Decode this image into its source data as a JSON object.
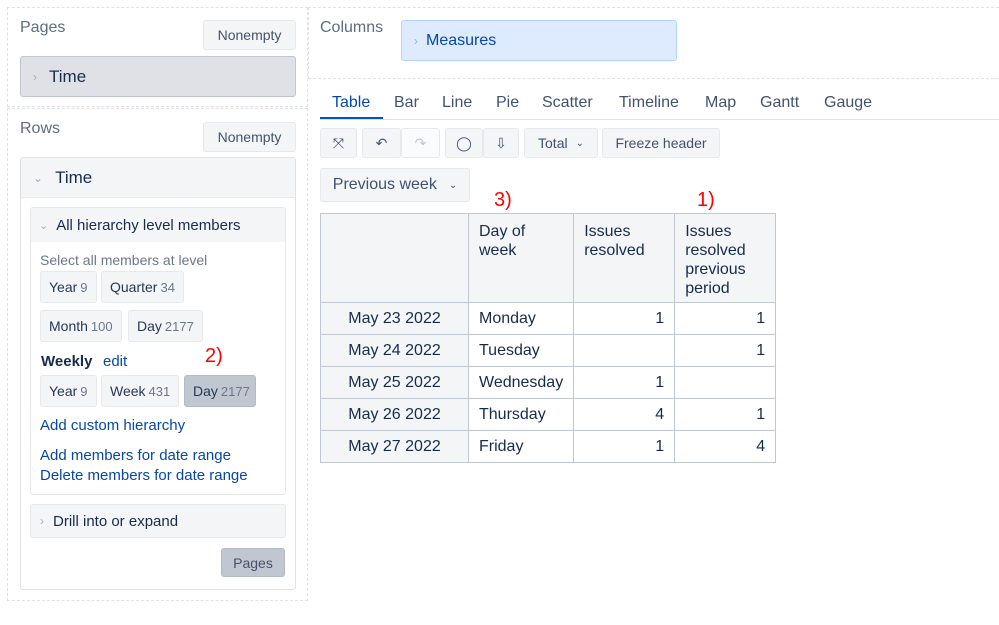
{
  "pages": {
    "title": "Pages",
    "nonempty": "Nonempty",
    "dimension": "Time"
  },
  "rows": {
    "title": "Rows",
    "nonempty": "Nonempty",
    "dimension": "Time",
    "all_members": {
      "title": "All hierarchy level members",
      "hint": "Select all members at level",
      "levels": [
        {
          "label": "Year",
          "count": "9"
        },
        {
          "label": "Quarter",
          "count": "34"
        },
        {
          "label": "Month",
          "count": "100"
        },
        {
          "label": "Day",
          "count": "2177"
        }
      ],
      "weekly": {
        "label": "Weekly",
        "edit": "edit",
        "levels": [
          {
            "label": "Year",
            "count": "9"
          },
          {
            "label": "Week",
            "count": "431"
          },
          {
            "label": "Day",
            "count": "2177"
          }
        ]
      },
      "add_custom": "Add custom hierarchy",
      "add_range": "Add members for date range",
      "delete_range": "Delete members for date range"
    },
    "drill": "Drill into or expand",
    "pages_button": "Pages"
  },
  "columns": {
    "title": "Columns",
    "measures": "Measures"
  },
  "tabs": [
    "Table",
    "Bar",
    "Line",
    "Pie",
    "Scatter",
    "Timeline",
    "Map",
    "Gantt",
    "Gauge"
  ],
  "toolbar": {
    "total": "Total",
    "freeze": "Freeze header",
    "filter": "Previous week"
  },
  "annotations": {
    "a1": "1)",
    "a2": "2)",
    "a3": "3)"
  },
  "table": {
    "headers": [
      "Day of week",
      "Issues resolved",
      "Issues resolved previous period"
    ],
    "rows": [
      {
        "date": "May 23 2022",
        "day": "Monday",
        "resolved": "1",
        "prev": "1"
      },
      {
        "date": "May 24 2022",
        "day": "Tuesday",
        "resolved": "",
        "prev": "1"
      },
      {
        "date": "May 25 2022",
        "day": "Wednesday",
        "resolved": "1",
        "prev": ""
      },
      {
        "date": "May 26 2022",
        "day": "Thursday",
        "resolved": "4",
        "prev": "1"
      },
      {
        "date": "May 27 2022",
        "day": "Friday",
        "resolved": "1",
        "prev": "4"
      }
    ]
  }
}
